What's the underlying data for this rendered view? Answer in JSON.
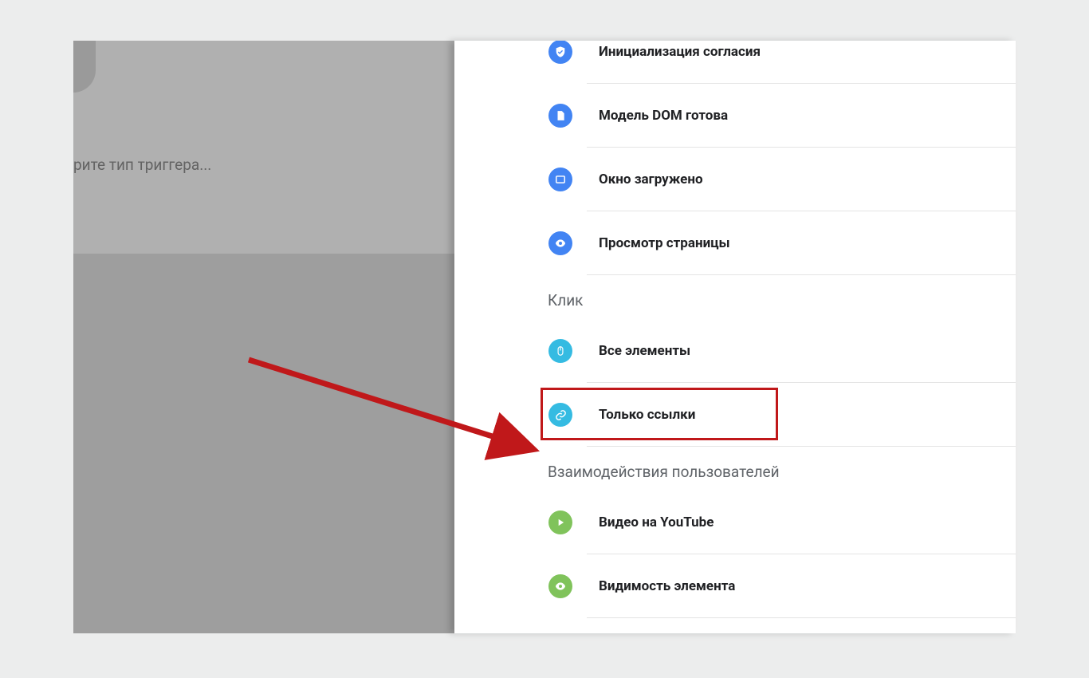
{
  "background": {
    "prompt_text": "рите тип триггера..."
  },
  "panel": {
    "group0": {
      "items": [
        {
          "label": "Инициализация согласия"
        },
        {
          "label": "Модель DOM готова"
        },
        {
          "label": "Окно загружено"
        },
        {
          "label": "Просмотр страницы"
        }
      ]
    },
    "group1": {
      "title": "Клик",
      "items": [
        {
          "label": "Все элементы"
        },
        {
          "label": "Только ссылки"
        }
      ]
    },
    "group2": {
      "title": "Взаимодействия пользователей",
      "items": [
        {
          "label": "Видео на YouTube"
        },
        {
          "label": "Видимость элемента"
        }
      ]
    }
  },
  "annotation": {
    "highlighted_item": "Только ссылки"
  }
}
